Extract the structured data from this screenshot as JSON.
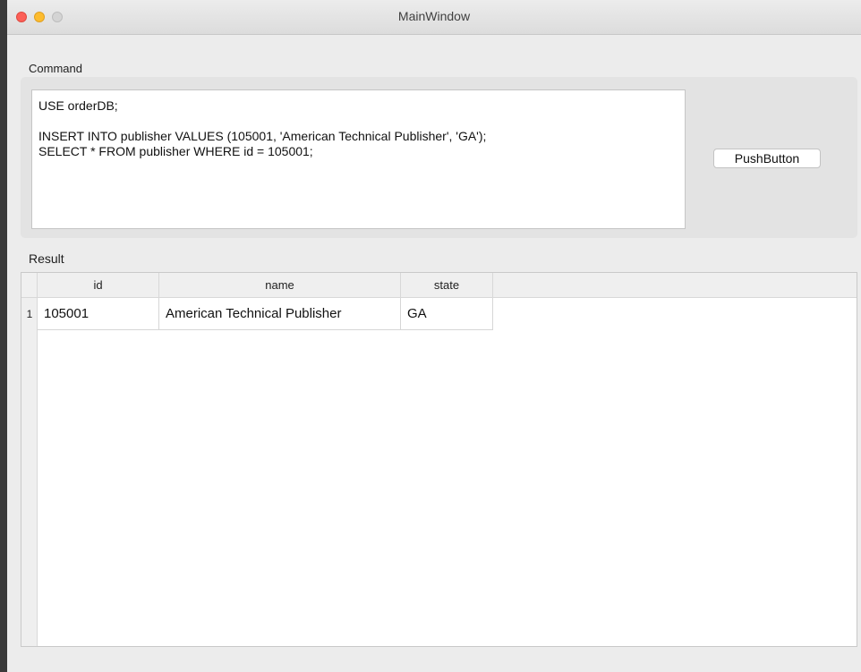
{
  "window": {
    "title": "MainWindow"
  },
  "command": {
    "group_label": "Command",
    "text": "USE orderDB;\n\nINSERT INTO publisher VALUES (105001, 'American Technical Publisher', 'GA');\nSELECT * FROM publisher WHERE id = 105001;",
    "button_label": "PushButton"
  },
  "result": {
    "group_label": "Result",
    "columns": [
      "id",
      "name",
      "state"
    ],
    "rows": [
      {
        "number": "1",
        "cells": [
          "105001",
          "American Technical Publisher",
          "GA"
        ]
      }
    ]
  }
}
